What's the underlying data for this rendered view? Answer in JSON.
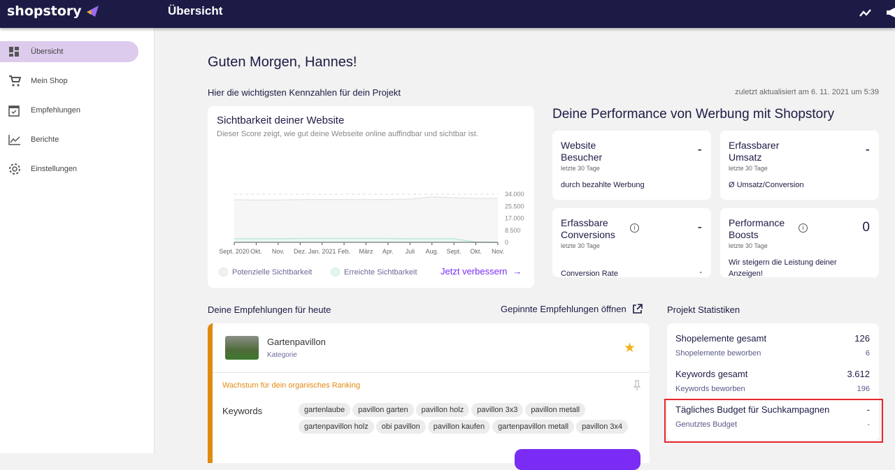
{
  "header": {
    "logo": "shopstory",
    "title": "Übersicht"
  },
  "sidebar": {
    "items": [
      {
        "label": "Übersicht"
      },
      {
        "label": "Mein Shop"
      },
      {
        "label": "Empfehlungen"
      },
      {
        "label": "Berichte"
      },
      {
        "label": "Einstellungen"
      }
    ]
  },
  "main": {
    "greeting": "Guten Morgen, Hannes!",
    "subtitle": "Hier die wichtigsten Kennzahlen für dein Projekt",
    "updated": "zuletzt aktualisiert am 6. 11. 2021 um 5:39",
    "visibility": {
      "title": "Sichtbarkeit deiner Website",
      "desc": "Dieser Score zeigt, wie gut deine Webseite online auffindbar und sichtbar ist.",
      "legend": [
        "Potenzielle Sichtbarkeit",
        "Erreichte Sichtbarkeit"
      ],
      "cta": "Jetzt verbessern"
    },
    "performance": {
      "title": "Deine Performance von Werbung mit Shopstory",
      "cards": [
        {
          "title1": "Website",
          "title2": "Besucher",
          "value": "-",
          "period": "letzte 30 Tage",
          "footer": "durch bezahlte Werbung",
          "footer_value": ""
        },
        {
          "title1": "Erfassbarer",
          "title2": "Umsatz",
          "value": "-",
          "period": "letzte 30 Tage",
          "footer": "Ø Umsatz/Conversion",
          "footer_value": ""
        },
        {
          "title1": "Erfassbare",
          "title2": "Conversions",
          "value": "-",
          "period": "letzte 30 Tage",
          "footer": "Conversion Rate",
          "footer_value": "-"
        },
        {
          "title1": "Performance",
          "title2": "Boosts",
          "value": "0",
          "period": "letzte 30 Tage",
          "footer": "Wir steigern die Leistung deiner Anzeigen!",
          "footer_value": ""
        }
      ]
    },
    "recommendations": {
      "title": "Deine Empfehlungen für heute",
      "pinned_link": "Gepinnte Empfehlungen öffnen",
      "item": {
        "name": "Gartenpavillon",
        "type": "Kategorie",
        "category": "Wachstum für dein organisches Ranking",
        "keywords_label": "Keywords",
        "keywords": [
          "gartenlaube",
          "pavillon garten",
          "pavillon holz",
          "pavillon 3x3",
          "pavillon metall",
          "gartenpavillon holz",
          "obi pavillon",
          "pavillon kaufen",
          "gartenpavillon metall",
          "pavillon 3x4"
        ]
      }
    },
    "stats": {
      "title": "Projekt Statistiken",
      "rows": [
        {
          "label": "Shopelemente gesamt",
          "value": "126",
          "sub": "Shopelemente beworben",
          "sub_value": "6"
        },
        {
          "label": "Keywords gesamt",
          "value": "3.612",
          "sub": "Keywords beworben",
          "sub_value": "196"
        },
        {
          "label": "Tägliches Budget für Suchkampagnen",
          "value": "-",
          "sub": "Genutztes Budget",
          "sub_value": "-"
        }
      ]
    }
  },
  "chart_data": {
    "type": "area",
    "x": [
      "Sept. 2020",
      "Okt.",
      "Nov.",
      "Dez.",
      "Jan. 2021",
      "Feb.",
      "März",
      "Apr.",
      "Juli",
      "Aug.",
      "Sept.",
      "Okt.",
      "Nov."
    ],
    "series": [
      {
        "name": "Potenzielle Sichtbarkeit",
        "color": "#e6e6e6",
        "values": [
          30000,
          29800,
          29800,
          30200,
          30200,
          30200,
          30200,
          30200,
          30500,
          32000,
          31500,
          31000,
          31000
        ]
      },
      {
        "name": "Erreichte Sichtbarkeit",
        "color": "#bfe8dc",
        "values": [
          2500,
          2500,
          2600,
          2700,
          2700,
          2700,
          2700,
          2700,
          2500,
          2500,
          2500,
          200,
          0
        ]
      }
    ],
    "yticks": [
      "34.000",
      "25.500",
      "17.000",
      "8.500",
      "0"
    ],
    "yvalues": [
      34000,
      25500,
      17000,
      8500,
      0
    ],
    "ylim": [
      0,
      34000
    ],
    "grid": true,
    "legend": "bottom"
  }
}
